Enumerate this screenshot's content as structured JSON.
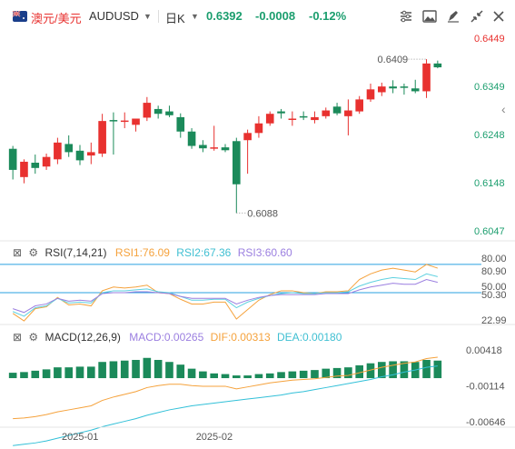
{
  "header": {
    "symbol_cn": "澳元/美元",
    "symbol_code": "AUDUSD",
    "timeframe": "日K",
    "last": "0.6392",
    "change": "-0.0008",
    "change_pct": "-0.12%"
  },
  "toolbar_icons": [
    "sliders-icon",
    "image-icon",
    "pen-icon",
    "pencil-erase-icon",
    "collapse-icon",
    "close-icon"
  ],
  "colors": {
    "up": "#e8312f",
    "down": "#1b8a5a",
    "green_text": "#1b9e6e",
    "rsi1": "#f5a23c",
    "rsi2": "#5fd1e0",
    "rsi3": "#9b7fe0",
    "macd_line": "#f5a23c",
    "dea_line": "#32c0d8",
    "accent_line": "#2aa0e0"
  },
  "price_axis": [
    "0.6449",
    "0.6349",
    "0.6248",
    "0.6148",
    "0.6047"
  ],
  "price_annotations": {
    "high": "0.6409",
    "low": "0.6088"
  },
  "rsi": {
    "title": "RSI(7,14,21)",
    "rsi1": "RSI1:76.09",
    "rsi2": "RSI2:67.36",
    "rsi3": "RSI3:60.60",
    "axis": [
      "80.00",
      "80.90",
      "50.00",
      "50.30",
      "22.99"
    ]
  },
  "macd": {
    "title": "MACD(12,26,9)",
    "macd": "MACD:0.00265",
    "dif": "DIF:0.00313",
    "dea": "DEA:0.00180",
    "axis": [
      "0.00418",
      "-0.00114",
      "-0.00646"
    ]
  },
  "x_axis": [
    "2025-01",
    "2025-02"
  ],
  "chart_data": [
    {
      "type": "candlestick",
      "name": "AUDUSD 日K",
      "ylim": [
        0.6047,
        0.6449
      ],
      "candles": [
        {
          "o": 0.6222,
          "h": 0.6228,
          "l": 0.6158,
          "c": 0.6178
        },
        {
          "o": 0.6163,
          "h": 0.62,
          "l": 0.615,
          "c": 0.6195
        },
        {
          "o": 0.6193,
          "h": 0.621,
          "l": 0.617,
          "c": 0.6182
        },
        {
          "o": 0.6185,
          "h": 0.6212,
          "l": 0.6178,
          "c": 0.6205
        },
        {
          "o": 0.62,
          "h": 0.6245,
          "l": 0.619,
          "c": 0.6235
        },
        {
          "o": 0.6232,
          "h": 0.625,
          "l": 0.6205,
          "c": 0.6215
        },
        {
          "o": 0.6218,
          "h": 0.623,
          "l": 0.6188,
          "c": 0.6198
        },
        {
          "o": 0.6208,
          "h": 0.6235,
          "l": 0.619,
          "c": 0.6215
        },
        {
          "o": 0.6212,
          "h": 0.6295,
          "l": 0.6205,
          "c": 0.628
        },
        {
          "o": 0.6282,
          "h": 0.6298,
          "l": 0.621,
          "c": 0.628
        },
        {
          "o": 0.628,
          "h": 0.6298,
          "l": 0.6265,
          "c": 0.6281
        },
        {
          "o": 0.6272,
          "h": 0.6285,
          "l": 0.6258,
          "c": 0.6285
        },
        {
          "o": 0.6287,
          "h": 0.633,
          "l": 0.628,
          "c": 0.6318
        },
        {
          "o": 0.6305,
          "h": 0.6312,
          "l": 0.6285,
          "c": 0.6295
        },
        {
          "o": 0.63,
          "h": 0.6312,
          "l": 0.6288,
          "c": 0.6292
        },
        {
          "o": 0.6288,
          "h": 0.6296,
          "l": 0.6245,
          "c": 0.6258
        },
        {
          "o": 0.6258,
          "h": 0.6265,
          "l": 0.6222,
          "c": 0.6228
        },
        {
          "o": 0.623,
          "h": 0.624,
          "l": 0.6215,
          "c": 0.6223
        },
        {
          "o": 0.6223,
          "h": 0.627,
          "l": 0.6218,
          "c": 0.6225
        },
        {
          "o": 0.6225,
          "h": 0.6232,
          "l": 0.6215,
          "c": 0.6219
        },
        {
          "o": 0.6238,
          "h": 0.6245,
          "l": 0.6088,
          "c": 0.6148
        },
        {
          "o": 0.624,
          "h": 0.6262,
          "l": 0.617,
          "c": 0.6255
        },
        {
          "o": 0.6255,
          "h": 0.629,
          "l": 0.6245,
          "c": 0.6275
        },
        {
          "o": 0.6275,
          "h": 0.63,
          "l": 0.627,
          "c": 0.6295
        },
        {
          "o": 0.63,
          "h": 0.6305,
          "l": 0.6285,
          "c": 0.6296
        },
        {
          "o": 0.6285,
          "h": 0.63,
          "l": 0.627,
          "c": 0.6285
        },
        {
          "o": 0.629,
          "h": 0.63,
          "l": 0.6282,
          "c": 0.6288
        },
        {
          "o": 0.6282,
          "h": 0.63,
          "l": 0.6275,
          "c": 0.6288
        },
        {
          "o": 0.629,
          "h": 0.6308,
          "l": 0.6285,
          "c": 0.6302
        },
        {
          "o": 0.631,
          "h": 0.6318,
          "l": 0.6292,
          "c": 0.6296
        },
        {
          "o": 0.629,
          "h": 0.6325,
          "l": 0.625,
          "c": 0.6302
        },
        {
          "o": 0.63,
          "h": 0.6332,
          "l": 0.6295,
          "c": 0.6325
        },
        {
          "o": 0.6325,
          "h": 0.6358,
          "l": 0.632,
          "c": 0.6346
        },
        {
          "o": 0.634,
          "h": 0.636,
          "l": 0.6332,
          "c": 0.6352
        },
        {
          "o": 0.6352,
          "h": 0.6365,
          "l": 0.6338,
          "c": 0.6348
        },
        {
          "o": 0.6352,
          "h": 0.6358,
          "l": 0.6335,
          "c": 0.635
        },
        {
          "o": 0.6348,
          "h": 0.6366,
          "l": 0.6338,
          "c": 0.6342
        },
        {
          "o": 0.6342,
          "h": 0.6409,
          "l": 0.6328,
          "c": 0.64
        },
        {
          "o": 0.64,
          "h": 0.6406,
          "l": 0.639,
          "c": 0.6392
        }
      ]
    },
    {
      "type": "line",
      "name": "RSI(7,14,21)",
      "ylim": [
        22.99,
        80.9
      ],
      "series": [
        {
          "name": "RSI1",
          "values": [
            28,
            20,
            33,
            35,
            45,
            37,
            38,
            36,
            52,
            56,
            55,
            56,
            58,
            50,
            49,
            43,
            38,
            38,
            40,
            40,
            22,
            32,
            42,
            48,
            52,
            52,
            50,
            49,
            51,
            51,
            52,
            64,
            70,
            74,
            76,
            74,
            72,
            80,
            76
          ]
        },
        {
          "name": "RSI2",
          "values": [
            30,
            25,
            34,
            36,
            44,
            39,
            40,
            39,
            50,
            52,
            52,
            53,
            54,
            51,
            50,
            46,
            42,
            42,
            43,
            43,
            34,
            40,
            44,
            47,
            49,
            50,
            49,
            49,
            50,
            50,
            51,
            57,
            61,
            64,
            66,
            65,
            64,
            70,
            67
          ]
        },
        {
          "name": "RSI3",
          "values": [
            33,
            29,
            36,
            38,
            44,
            41,
            42,
            41,
            49,
            50,
            50,
            51,
            51,
            50,
            49,
            46,
            44,
            44,
            44,
            44,
            38,
            42,
            45,
            47,
            48,
            48,
            48,
            48,
            49,
            49,
            49,
            53,
            56,
            58,
            60,
            59,
            59,
            64,
            61
          ]
        }
      ]
    },
    {
      "type": "bar+line",
      "name": "MACD(12,26,9)",
      "ylim": [
        -0.00646,
        0.00418
      ],
      "macd": [
        0.0008,
        0.0009,
        0.0011,
        0.0013,
        0.0016,
        0.0016,
        0.0017,
        0.0017,
        0.0024,
        0.0025,
        0.0026,
        0.0027,
        0.003,
        0.0027,
        0.0024,
        0.002,
        0.0014,
        0.001,
        0.0007,
        0.0006,
        0.0004,
        0.0004,
        0.0006,
        0.0007,
        0.0009,
        0.001,
        0.0011,
        0.0012,
        0.0014,
        0.0015,
        0.0016,
        0.0019,
        0.0022,
        0.0024,
        0.0025,
        0.0025,
        0.0024,
        0.0027,
        0.0026
      ],
      "dif": [
        -0.006,
        -0.0059,
        -0.0057,
        -0.0054,
        -0.005,
        -0.0047,
        -0.0044,
        -0.0041,
        -0.0033,
        -0.0028,
        -0.0024,
        -0.002,
        -0.0014,
        -0.0011,
        -0.0009,
        -0.0009,
        -0.0011,
        -0.0012,
        -0.0012,
        -0.0012,
        -0.0016,
        -0.0013,
        -0.001,
        -0.0007,
        -0.0005,
        -0.0003,
        -0.0002,
        -0.0001,
        0.0001,
        0.0003,
        0.0004,
        0.0008,
        0.0012,
        0.0016,
        0.0019,
        0.0022,
        0.0024,
        0.0029,
        0.0031
      ],
      "dea": [
        -0.01,
        -0.0098,
        -0.0096,
        -0.0093,
        -0.0089,
        -0.0085,
        -0.0081,
        -0.0077,
        -0.0072,
        -0.0068,
        -0.0064,
        -0.006,
        -0.0055,
        -0.0051,
        -0.0047,
        -0.0044,
        -0.0041,
        -0.0039,
        -0.0037,
        -0.0035,
        -0.0033,
        -0.0031,
        -0.0029,
        -0.0027,
        -0.0025,
        -0.0022,
        -0.002,
        -0.0017,
        -0.0014,
        -0.0011,
        -0.0008,
        -0.0005,
        -0.0002,
        0.0002,
        0.0005,
        0.0009,
        0.0012,
        0.0016,
        0.0018
      ]
    }
  ]
}
